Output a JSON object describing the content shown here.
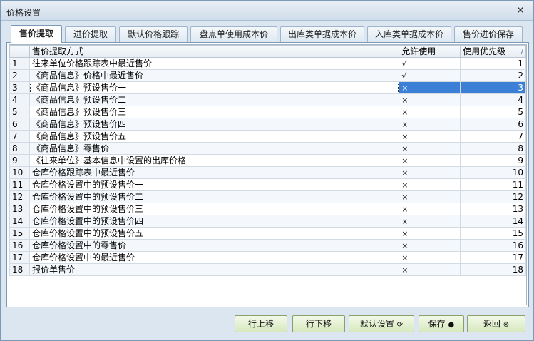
{
  "window": {
    "title": "价格设置",
    "close_icon": "close-icon"
  },
  "tabs": [
    {
      "label": "售价提取",
      "active": true
    },
    {
      "label": "进价提取",
      "active": false
    },
    {
      "label": "默认价格跟踪",
      "active": false
    },
    {
      "label": "盘点单使用成本价",
      "active": false
    },
    {
      "label": "出库类单据成本价",
      "active": false
    },
    {
      "label": "入库类单据成本价",
      "active": false
    },
    {
      "label": "售价进价保存",
      "active": false
    }
  ],
  "grid": {
    "headers": {
      "num": "",
      "method": "售价提取方式",
      "allow": "允许使用",
      "priority": "使用优先级",
      "sort_mark": "/"
    },
    "selected_row": 3,
    "rows": [
      {
        "num": "1",
        "method": "往来单位价格跟踪表中最近售价",
        "allow": "√",
        "priority": "1"
      },
      {
        "num": "2",
        "method": "《商品信息》价格中最近售价",
        "allow": "√",
        "priority": "2"
      },
      {
        "num": "3",
        "method": "《商品信息》预设售价一",
        "allow": "×",
        "priority": "3"
      },
      {
        "num": "4",
        "method": "《商品信息》预设售价二",
        "allow": "×",
        "priority": "4"
      },
      {
        "num": "5",
        "method": "《商品信息》预设售价三",
        "allow": "×",
        "priority": "5"
      },
      {
        "num": "6",
        "method": "《商品信息》预设售价四",
        "allow": "×",
        "priority": "6"
      },
      {
        "num": "7",
        "method": "《商品信息》预设售价五",
        "allow": "×",
        "priority": "7"
      },
      {
        "num": "8",
        "method": "《商品信息》零售价",
        "allow": "×",
        "priority": "8"
      },
      {
        "num": "9",
        "method": "《往来单位》基本信息中设置的出库价格",
        "allow": "×",
        "priority": "9"
      },
      {
        "num": "10",
        "method": "仓库价格跟踪表中最近售价",
        "allow": "×",
        "priority": "10"
      },
      {
        "num": "11",
        "method": "仓库价格设置中的预设售价一",
        "allow": "×",
        "priority": "11"
      },
      {
        "num": "12",
        "method": "仓库价格设置中的预设售价二",
        "allow": "×",
        "priority": "12"
      },
      {
        "num": "13",
        "method": "仓库价格设置中的预设售价三",
        "allow": "×",
        "priority": "13"
      },
      {
        "num": "14",
        "method": "仓库价格设置中的预设售价四",
        "allow": "×",
        "priority": "14"
      },
      {
        "num": "15",
        "method": "仓库价格设置中的预设售价五",
        "allow": "×",
        "priority": "15"
      },
      {
        "num": "16",
        "method": "仓库价格设置中的零售价",
        "allow": "×",
        "priority": "16"
      },
      {
        "num": "17",
        "method": "仓库价格设置中的最近售价",
        "allow": "×",
        "priority": "17"
      },
      {
        "num": "18",
        "method": "报价单售价",
        "allow": "×",
        "priority": "18"
      }
    ]
  },
  "buttons": {
    "move_up": "行上移",
    "move_down": "行下移",
    "default_settings": "默认设置",
    "save": "保存",
    "back": "返回"
  },
  "colors": {
    "selection": "#3c7fd6",
    "button_bg": "#d7e9bf"
  }
}
